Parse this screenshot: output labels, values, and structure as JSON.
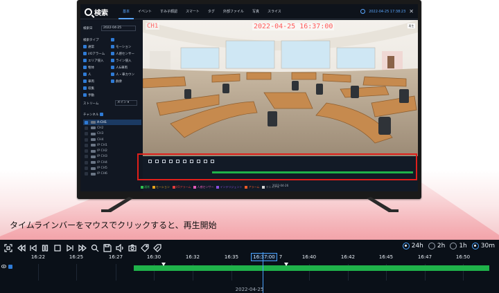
{
  "app": {
    "title": "検索",
    "tabs": [
      "基本",
      "イベント",
      "すみ子顔認",
      "スマート",
      "タグ",
      "外部ファイル",
      "写真",
      "スライス"
    ],
    "datetime": "2022-04-25 17:38:23"
  },
  "left_panel": {
    "date_label": "検索日",
    "date_value": "2022-04-25",
    "search_type_label": "検索タイプ",
    "types": [
      "通常",
      "モーション",
      "I/Oアラーム",
      "人感センサー",
      "エリア侵入",
      "ライン侵入",
      "物体",
      "人&車両",
      "人",
      "人・車カウン",
      "車両",
      "群衆",
      "収集",
      "手動"
    ],
    "stream_label": "ストリーム",
    "stream_value": "メイン",
    "channel_label": "チャンネル",
    "channels": [
      "A-CH1",
      "CH2",
      "CH3",
      "CH4",
      "IP CH1",
      "IP CH2",
      "IP CH3",
      "IP CH4",
      "IP CH5",
      "IP CH6"
    ]
  },
  "video": {
    "channel": "CH1",
    "timestamp": "2022-04-25  16:37:00",
    "badge": "再生"
  },
  "mini_timeline": {
    "legend": [
      "通常",
      "モーション",
      "I/Oアラーム",
      "人感センサー",
      "インテリジェント",
      "アラーム",
      "マニュアル"
    ],
    "legend_colors": [
      "#2fbf4f",
      "#e8a31b",
      "#e23b3b",
      "#e25ab8",
      "#8a4fe0",
      "#f05a28",
      "#d4d4d4"
    ],
    "date": "2022-04-26"
  },
  "caption": "タイムラインバーをマウスでクリックすると、再生開始",
  "timeline": {
    "zoom_options": [
      "24h",
      "2h",
      "1h",
      "30m"
    ],
    "zoom_selected": "30m",
    "ticks": [
      "16:22",
      "16:25",
      "16:27",
      "16:30",
      "16:32",
      "16:35",
      "16:37",
      "16:40",
      "16:42",
      "16:45",
      "16:47",
      "16:50"
    ],
    "current_time": "16:37:00",
    "date": "2022-04-25",
    "accent_color": "#4aa3ff",
    "record_color": "#1fb24a"
  }
}
